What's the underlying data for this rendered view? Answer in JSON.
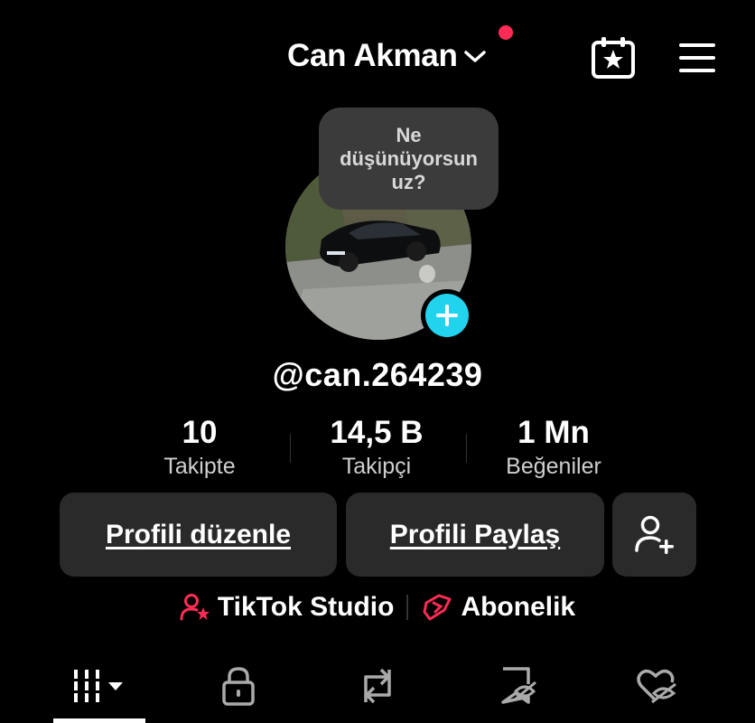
{
  "header": {
    "title": "Can Akman",
    "has_notification": true,
    "icons": [
      "chevron-down-icon",
      "calendar-star-icon",
      "hamburger-menu-icon"
    ]
  },
  "profile": {
    "bubble_text": "Ne düşünüyorsun uz?",
    "username": "@can.264239"
  },
  "stats": [
    {
      "value": "10",
      "label": "Takipte"
    },
    {
      "value": "14,5 B",
      "label": "Takipçi"
    },
    {
      "value": "1 Mn",
      "label": "Beğeniler"
    }
  ],
  "buttons": {
    "edit_profile": "Profili düzenle",
    "share_profile": "Profili Paylaş"
  },
  "links": {
    "studio": "TikTok Studio",
    "subscription": "Abonelik"
  },
  "tabs": [
    "videos-grid-icon",
    "lock-icon",
    "repost-icon",
    "favorites-icon",
    "liked-icon"
  ],
  "colors": {
    "background": "#000000",
    "accent_red": "#fe2c55",
    "accent_cyan": "#22d3ee",
    "button_bg": "#2a2a2a"
  }
}
